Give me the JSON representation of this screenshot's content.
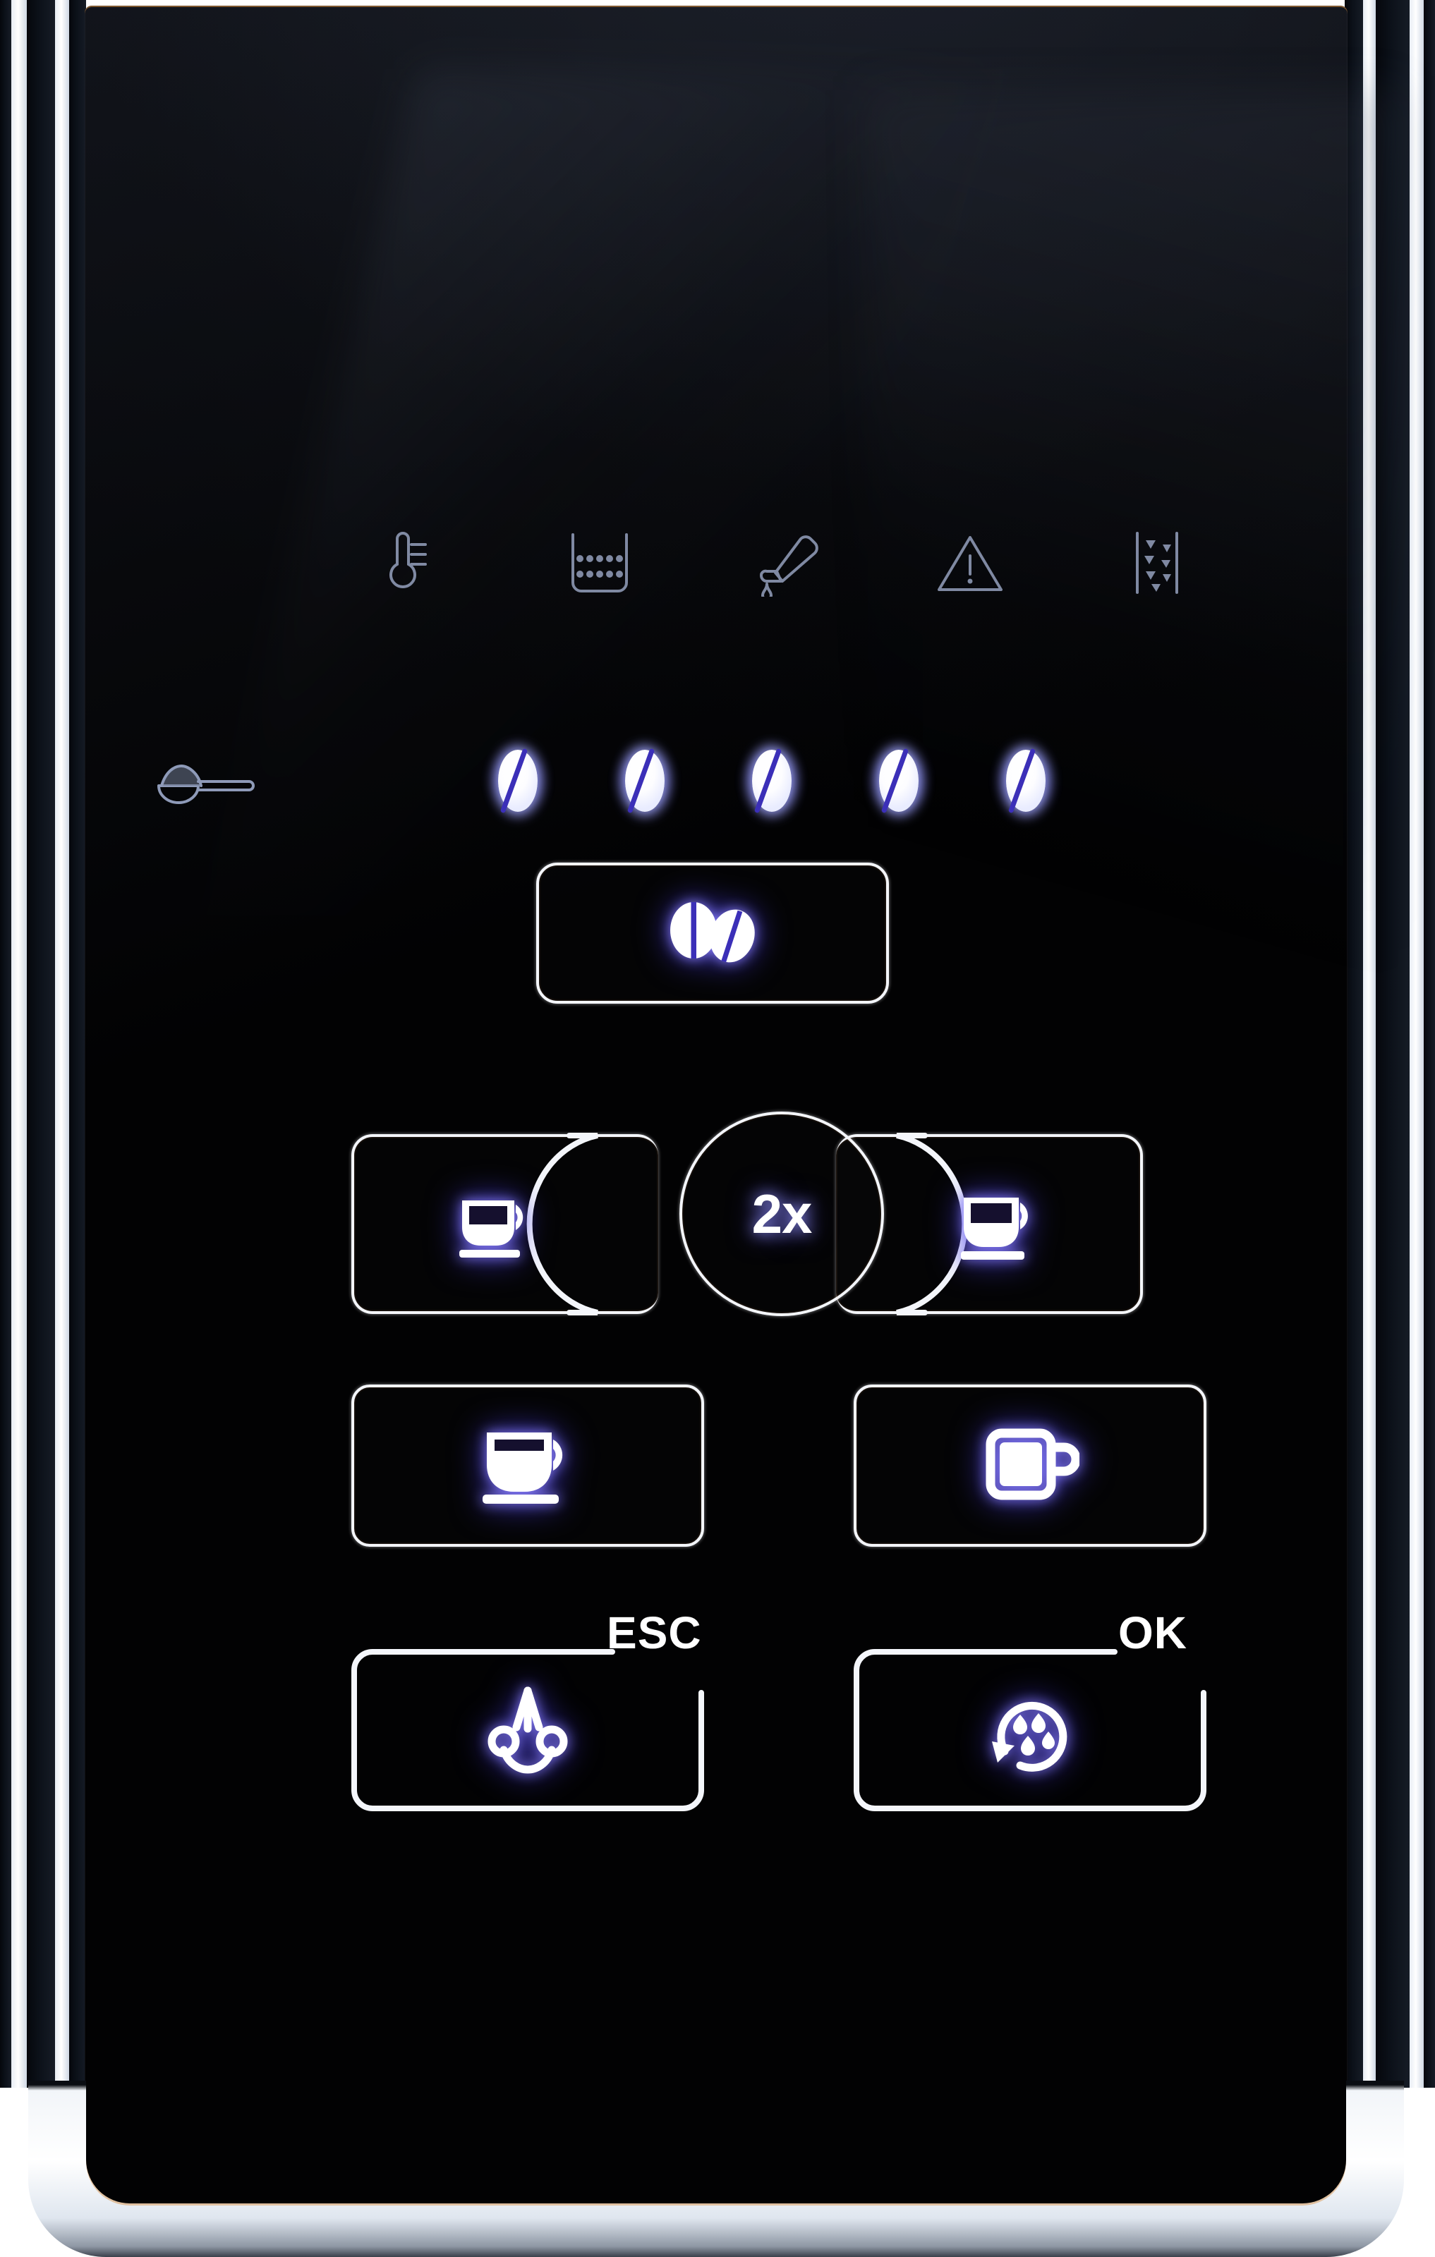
{
  "device": {
    "name": "Espresso machine control panel",
    "panel_finish": "black glossy glass with chrome bezel",
    "colors": {
      "glass": "#020203",
      "chrome": "#ffffff",
      "led_white": "#ffffff",
      "led_glow": "#6a5cff",
      "led_slit": "#3b2fb8",
      "bezel_warm_edge": "#d68c3c"
    }
  },
  "status_indicators": [
    {
      "id": "temperature",
      "icon": "thermometer-icon",
      "label": "Temperature",
      "state": "off"
    },
    {
      "id": "grounds_container",
      "icon": "grounds-drawer-icon",
      "label": "Grounds container",
      "state": "off"
    },
    {
      "id": "water_tank",
      "icon": "water-fill-icon",
      "label": "Fill water tank",
      "state": "off"
    },
    {
      "id": "general_alert",
      "icon": "warning-triangle-icon",
      "label": "General warning",
      "state": "off"
    },
    {
      "id": "bean_hopper",
      "icon": "bean-hopper-icon",
      "label": "Bean hopper empty",
      "state": "off"
    }
  ],
  "strength_row": {
    "ground_coffee": {
      "icon": "coffee-spoon-icon",
      "label": "Pre-ground coffee",
      "state": "off"
    },
    "level_label": "Coffee strength",
    "levels_total": 5,
    "levels_lit": 5,
    "leds": [
      {
        "index": 1,
        "icon": "coffee-bean-icon",
        "state": "on"
      },
      {
        "index": 2,
        "icon": "coffee-bean-icon",
        "state": "on"
      },
      {
        "index": 3,
        "icon": "coffee-bean-icon",
        "state": "on"
      },
      {
        "index": 4,
        "icon": "coffee-bean-icon",
        "state": "on"
      },
      {
        "index": 5,
        "icon": "coffee-bean-icon",
        "state": "on"
      }
    ]
  },
  "buttons": {
    "strength": {
      "icon": "two-coffee-beans-icon",
      "label": "Coffee strength",
      "state": "lit"
    },
    "espresso_left": {
      "icon": "espresso-cup-icon",
      "label": "Espresso",
      "state": "lit"
    },
    "double_shot": {
      "text": "2x",
      "label": "Double shot",
      "state": "lit"
    },
    "espresso_right": {
      "icon": "espresso-cup-icon",
      "label": "Espresso large",
      "state": "lit"
    },
    "coffee": {
      "icon": "coffee-cup-icon",
      "label": "Coffee",
      "state": "lit"
    },
    "mug": {
      "icon": "coffee-mug-icon",
      "label": "Large mug",
      "state": "lit"
    },
    "steam": {
      "icon": "steam-nozzle-icon",
      "label": "Steam / milk froth",
      "corner_label": "ESC",
      "state": "lit"
    },
    "rinse": {
      "icon": "rinse-cycle-icon",
      "label": "Rinse / clean",
      "corner_label": "OK",
      "state": "lit"
    }
  }
}
